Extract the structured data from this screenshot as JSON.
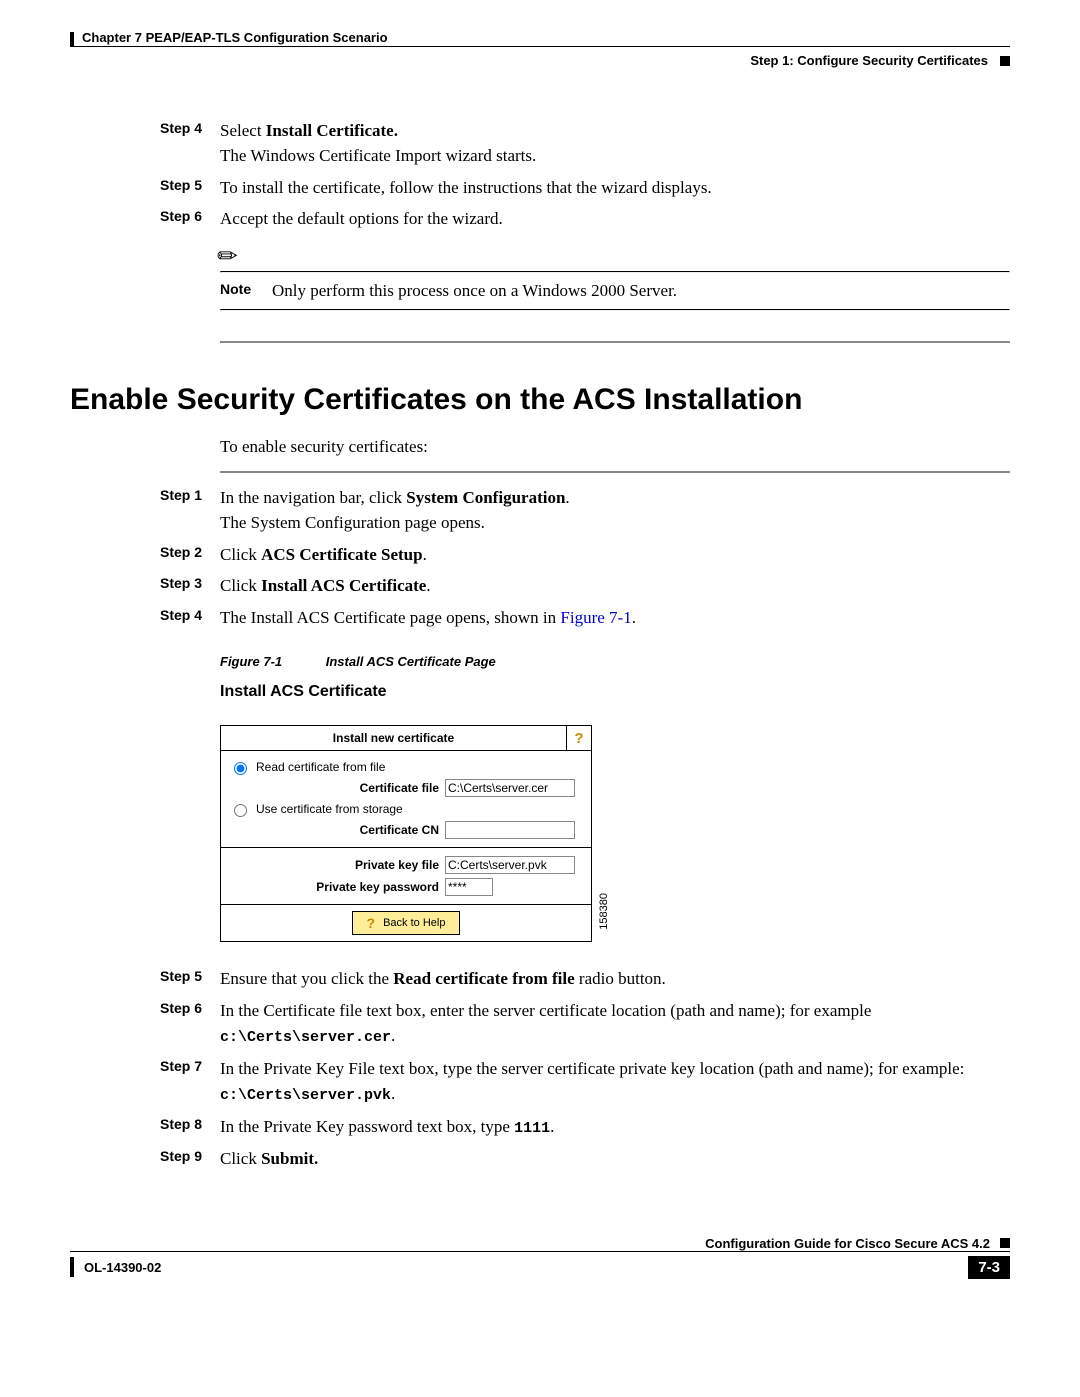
{
  "header": {
    "chapter": "Chapter 7      PEAP/EAP-TLS Configuration Scenario",
    "section": "Step 1: Configure Security Certificates"
  },
  "top_steps": {
    "s4": {
      "lbl": "Step 4",
      "pre": "Select ",
      "bold": "Install Certificate.",
      "line2": "The Windows Certificate Import wizard starts."
    },
    "s5": {
      "lbl": "Step 5",
      "text": "To install the certificate, follow the instructions that the wizard displays."
    },
    "s6": {
      "lbl": "Step 6",
      "text": "Accept the default options for the wizard."
    }
  },
  "note": {
    "lbl": "Note",
    "text": "Only perform this process once on a Windows 2000 Server."
  },
  "section_title": "Enable Security Certificates on the ACS Installation",
  "intro": "To enable security certificates:",
  "steps": {
    "s1": {
      "lbl": "Step 1",
      "pre": "In the navigation bar, click ",
      "bold": "System Configuration",
      "post": ".",
      "line2": "The System Configuration page opens."
    },
    "s2": {
      "lbl": "Step 2",
      "pre": "Click ",
      "bold": "ACS Certificate Setup",
      "post": "."
    },
    "s3": {
      "lbl": "Step 3",
      "pre": "Click ",
      "bold": "Install ACS Certificate",
      "post": "."
    },
    "s4": {
      "lbl": "Step 4",
      "pre": "The Install ACS Certificate page opens, shown in ",
      "link": "Figure 7-1",
      "post": "."
    },
    "s5": {
      "lbl": "Step 5",
      "pre": "Ensure that you click the ",
      "bold": "Read certificate from file",
      "post": " radio button."
    },
    "s6": {
      "lbl": "Step 6",
      "text": "In the Certificate file text box, enter the server certificate location (path and name); for example ",
      "code": "c:\\Certs\\server.cer",
      "post": "."
    },
    "s7": {
      "lbl": "Step 7",
      "text": "In the Private Key File text box, type the server certificate private key location (path and name); for example: ",
      "code": "c:\\Certs\\server.pvk",
      "post": "."
    },
    "s8": {
      "lbl": "Step 8",
      "text": "In the Private Key password text box, type ",
      "code": "1111",
      "post": "."
    },
    "s9": {
      "lbl": "Step 9",
      "pre": "Click ",
      "bold": "Submit.",
      "post": ""
    }
  },
  "figure": {
    "id": "Figure 7-1",
    "caption": "Install ACS Certificate Page",
    "title": "Install ACS Certificate",
    "sideid": "158380"
  },
  "dialog": {
    "title": "Install new certificate",
    "help": "?",
    "radio_file": "Read certificate from file",
    "certfile_lbl": "Certificate file",
    "certfile_val": "C:\\Certs\\server.cer",
    "radio_storage": "Use certificate from storage",
    "certcn_lbl": "Certificate CN",
    "pkfile_lbl": "Private key file",
    "pkfile_val": "C:Certs\\server.pvk",
    "pkpass_lbl": "Private key password",
    "pkpass_val": "****",
    "back": "Back to Help"
  },
  "footer": {
    "guide": "Configuration Guide for Cisco Secure ACS 4.2",
    "docid": "OL-14390-02",
    "page": "7-3"
  }
}
